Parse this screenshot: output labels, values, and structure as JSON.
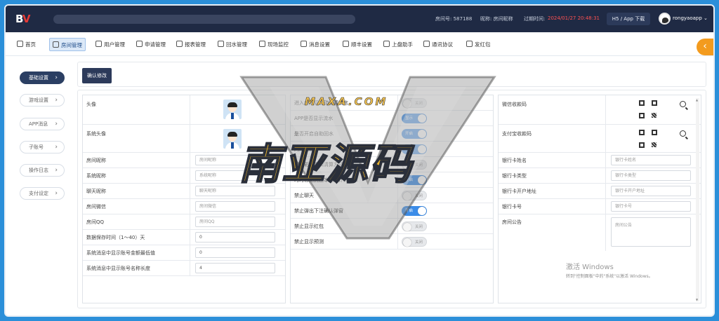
{
  "logo": {
    "b": "B",
    "v": "V"
  },
  "topbar": {
    "room_no_label": "房间号: 587188",
    "nickname_label": "昵称: 房间昵称",
    "expire_label": "过期时间:",
    "expire_value": "2024/01/27 20:48:31",
    "h5_button": "H5 / App 下载",
    "username": "rongyaoapp",
    "user_caret": "⌄"
  },
  "nav": {
    "items": [
      "首页",
      "房间管理",
      "用户管理",
      "申请管理",
      "报表管理",
      "回水管理",
      "现场监控",
      "消息设置",
      "顺丰设置",
      "上盘助手",
      "通讯协议",
      "发红包"
    ],
    "active": "房间管理",
    "collapse_glyph": "‹"
  },
  "side": {
    "items": [
      "基础设置",
      "游戏设置",
      "APP消息",
      "子账号",
      "操作日志",
      "支付设定"
    ],
    "active": "基础设置"
  },
  "toolbar": {
    "confirm_label": "确认修改"
  },
  "col1": {
    "rows": [
      {
        "label": "头像"
      },
      {
        "label": "系统头像"
      },
      {
        "label": "房间昵称",
        "placeholder": "房间昵称"
      },
      {
        "label": "系统昵称",
        "placeholder": "系统昵称"
      },
      {
        "label": "聊天昵称",
        "placeholder": "聊天昵称"
      },
      {
        "label": "房间微信",
        "placeholder": "房间微信"
      },
      {
        "label": "房间QQ",
        "placeholder": "房间QQ"
      },
      {
        "label": "数据保存时间（1～40）天",
        "value": "0"
      },
      {
        "label": "系统消息中显示账号金额最低值",
        "value": "0"
      },
      {
        "label": "系统消息中显示账号名称长度",
        "value": "4"
      }
    ]
  },
  "col2": {
    "rows": [
      {
        "label": "进入房间后自动设置禁言",
        "state": "关闭",
        "on": false
      },
      {
        "label": "APP是否显示流水",
        "state": "显示",
        "on": true
      },
      {
        "label": "是否开启自助回水",
        "state": "开启",
        "on": true
      },
      {
        "label": "网络健盘",
        "state": "开启",
        "on": true
      },
      {
        "label": "时时彩龙虎和清算方式",
        "state": "关闭",
        "on": false
      },
      {
        "label": "时时彩龙虎还本是否计算流水",
        "state": "开启",
        "on": true
      },
      {
        "label": "禁止聊天",
        "state": "关闭",
        "on": false
      },
      {
        "label": "禁止弹出下注确认弹窗",
        "state": "开启",
        "on": true
      },
      {
        "label": "禁止显示红包",
        "state": "关闭",
        "on": false
      },
      {
        "label": "禁止显示预测",
        "state": "关闭",
        "on": false
      }
    ]
  },
  "col3": {
    "rows": [
      {
        "label": "微信收款码"
      },
      {
        "label": "支付宝收款码"
      },
      {
        "label": "银行卡姓名",
        "placeholder": "银行卡姓名"
      },
      {
        "label": "银行卡类型",
        "placeholder": "银行卡类型"
      },
      {
        "label": "银行卡开户地址",
        "placeholder": "银行卡开户地址"
      },
      {
        "label": "银行卡号",
        "placeholder": "银行卡号"
      },
      {
        "label": "房间公告",
        "placeholder": "房间公告"
      }
    ]
  },
  "watermark": {
    "small": "MAXA.COM",
    "big": "南亚源码"
  },
  "windows": {
    "title": "激活 Windows",
    "subtitle": "转到\"控制面板\"中的\"系统\"以激活 Windows。"
  },
  "colors": {
    "header": "#1f2a44",
    "accent": "#3b8ce8",
    "orange": "#f39b1e",
    "red": "#ff5252"
  }
}
